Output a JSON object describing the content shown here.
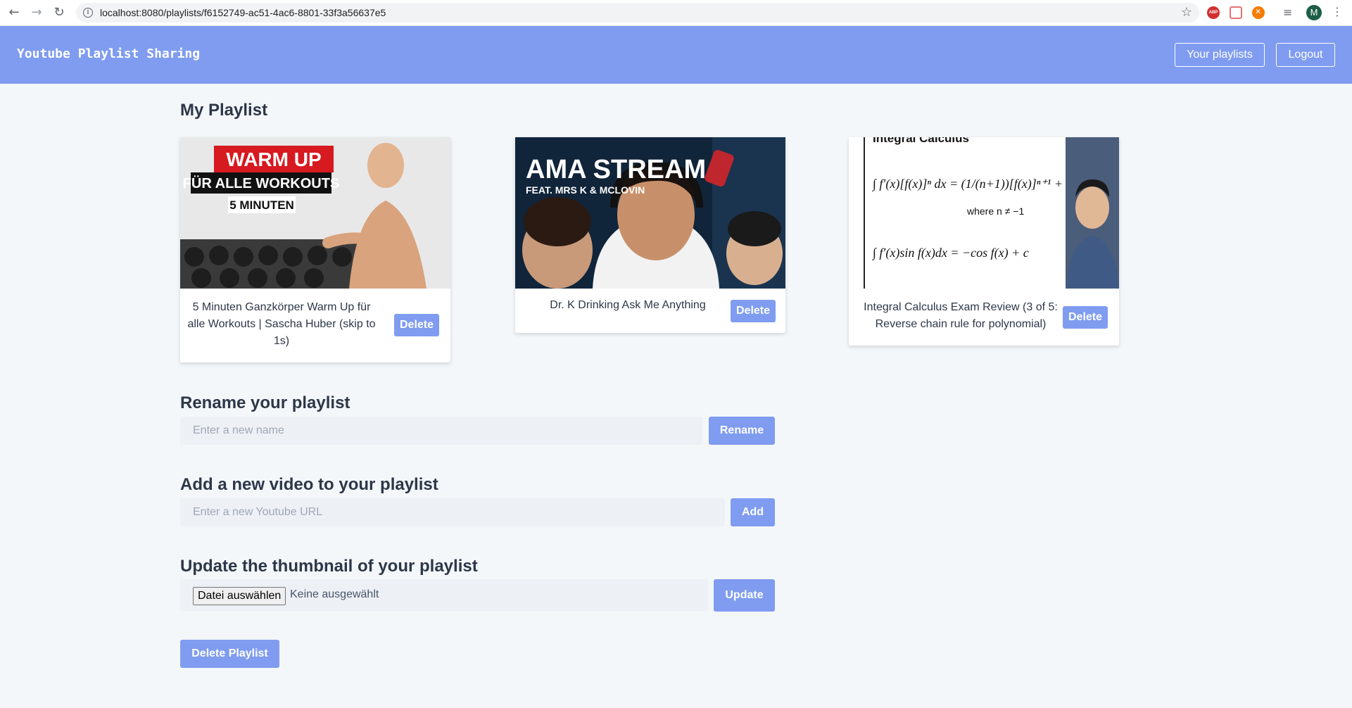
{
  "browser": {
    "url": "localhost:8080/playlists/f6152749-ac51-4ac6-8801-33f3a56637e5",
    "avatar_letter": "M",
    "abp_label": "ABP"
  },
  "header": {
    "brand": "Youtube Playlist Sharing",
    "your_playlists_label": "Your playlists",
    "logout_label": "Logout"
  },
  "playlist": {
    "title": "My Playlist",
    "videos": [
      {
        "title": "5 Minuten Ganzkörper Warm Up für alle Workouts | Sascha Huber (skip to 1s)",
        "delete_label": "Delete",
        "thumb_lines": [
          "WARM UP",
          "FÜR ALLE WORKOUTS",
          "5 MINUTEN"
        ]
      },
      {
        "title": "Dr. K Drinking Ask Me Anything",
        "delete_label": "Delete",
        "thumb_lines": [
          "AMA STREAM",
          "FEAT. MRS K & MCLOVIN"
        ]
      },
      {
        "title": "Integral Calculus Exam Review (3 of 5: Reverse chain rule for polynomial)",
        "delete_label": "Delete",
        "thumb_lines": [
          "Integral Calculus",
          "where n ≠ −1"
        ]
      }
    ]
  },
  "rename": {
    "heading": "Rename your playlist",
    "placeholder": "Enter a new name",
    "button": "Rename"
  },
  "add_video": {
    "heading": "Add a new video to your playlist",
    "placeholder": "Enter a new Youtube URL",
    "button": "Add"
  },
  "thumbnail": {
    "heading": "Update the thumbnail of your playlist",
    "choose_label": "Datei auswählen",
    "status": "Keine ausgewählt",
    "button": "Update"
  },
  "delete_playlist_label": "Delete Playlist",
  "colors": {
    "accent": "#7f9cf0",
    "background": "#f4f7fa",
    "input_bg": "#edf0f5"
  }
}
